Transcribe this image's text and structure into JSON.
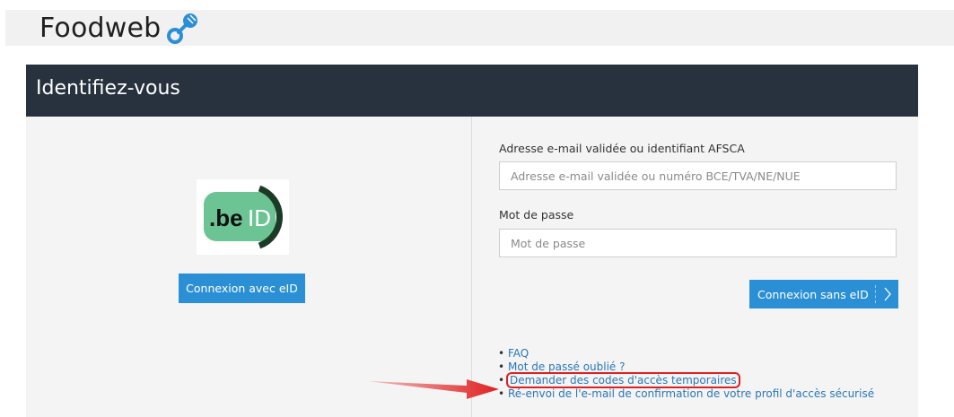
{
  "header": {
    "brand": "Foodweb"
  },
  "panel": {
    "title": "Identifiez-vous"
  },
  "eid": {
    "logo_text_be": ".be",
    "logo_text_id": "ID",
    "button_label": "Connexion avec eID"
  },
  "login": {
    "email_label": "Adresse e-mail validée ou identifiant AFSCA",
    "email_placeholder": "Adresse e-mail validée ou numéro BCE/TVA/NE/NUE",
    "email_value": "",
    "password_label": "Mot de passe",
    "password_placeholder": "Mot de passe",
    "password_value": "",
    "button_label": "Connexion sans eID"
  },
  "links": [
    {
      "label": "FAQ"
    },
    {
      "label": "Mot de passé oublié ?"
    },
    {
      "label": "Demander des codes d'accès temporaires",
      "highlighted": true
    },
    {
      "label": "Ré-envoi de l'e-mail de confirmation de votre profil d'accès sécurisé"
    }
  ],
  "colors": {
    "header_bg": "#27323e",
    "primary_button": "#2b8fd6",
    "link": "#2a77b8",
    "annotation": "#e02020",
    "beid_green": "#6cc393"
  }
}
